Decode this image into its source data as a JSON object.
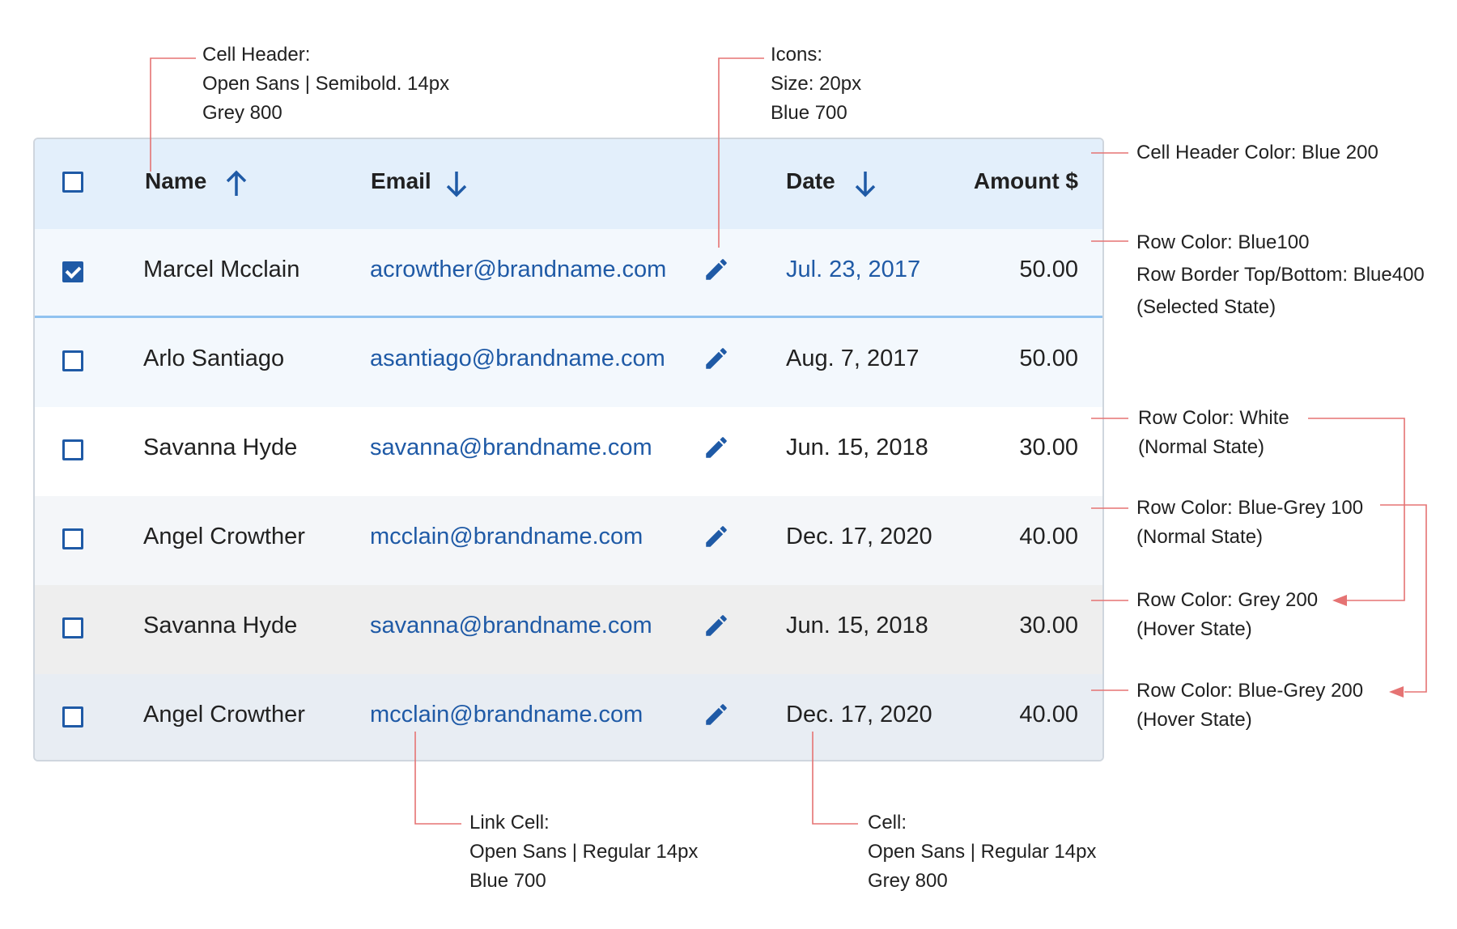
{
  "table": {
    "headers": {
      "name": "Name",
      "email": "Email",
      "date": "Date",
      "amount": "Amount $"
    },
    "rows": [
      {
        "name": "Marcel Mcclain",
        "email": "acrowther@brandname.com",
        "date": "Jul. 23, 2017",
        "amount": "50.00",
        "checked": true,
        "bg": "#f3f8fd"
      },
      {
        "name": "Arlo Santiago",
        "email": "asantiago@brandname.com",
        "date": "Aug. 7, 2017",
        "amount": "50.00",
        "checked": false,
        "bg": "#f3f8fd"
      },
      {
        "name": "Savanna Hyde",
        "email": "savanna@brandname.com",
        "date": "Jun. 15, 2018",
        "amount": "30.00",
        "checked": false,
        "bg": "#ffffff"
      },
      {
        "name": "Angel Crowther",
        "email": "mcclain@brandname.com",
        "date": "Dec. 17, 2020",
        "amount": "40.00",
        "checked": false,
        "bg": "#f4f6f9"
      },
      {
        "name": "Savanna Hyde",
        "email": "savanna@brandname.com",
        "date": "Jun. 15, 2018",
        "amount": "30.00",
        "checked": false,
        "bg": "#eeeeee"
      },
      {
        "name": "Angel Crowther",
        "email": "mcclain@brandname.com",
        "date": "Dec. 17, 2020",
        "amount": "40.00",
        "checked": false,
        "bg": "#e8edf3"
      }
    ]
  },
  "annotations": {
    "cell_header": [
      "Cell Header:",
      "Open Sans | Semibold. 14px",
      "Grey 800"
    ],
    "icons": [
      "Icons:",
      "Size: 20px",
      "Blue 700"
    ],
    "header_color": [
      "Cell Header Color: Blue 200"
    ],
    "row_selected": [
      "Row Color: Blue100",
      "Row Border Top/Bottom: Blue400",
      "(Selected State)"
    ],
    "row_white": [
      "Row Color: White",
      "(Normal State)"
    ],
    "row_bluegrey100": [
      "Row Color: Blue-Grey 100",
      "(Normal State)"
    ],
    "row_grey200": [
      "Row Color: Grey 200",
      "(Hover State)"
    ],
    "row_bluegrey200": [
      "Row Color: Blue-Grey 200",
      "(Hover State)"
    ],
    "link_cell": [
      "Link Cell:",
      "Open Sans | Regular 14px",
      "Blue 700"
    ],
    "cell": [
      "Cell:",
      "Open Sans | Regular 14px",
      "Grey 800"
    ]
  },
  "colors": {
    "blue700": "#1f5aa6",
    "blue400": "#90c2f0",
    "blue200": "#e3effb",
    "annotation_line": "#e57373"
  },
  "icons": {
    "sort_asc": "arrow-up-icon",
    "sort_desc": "arrow-down-icon",
    "edit": "pencil-icon"
  }
}
